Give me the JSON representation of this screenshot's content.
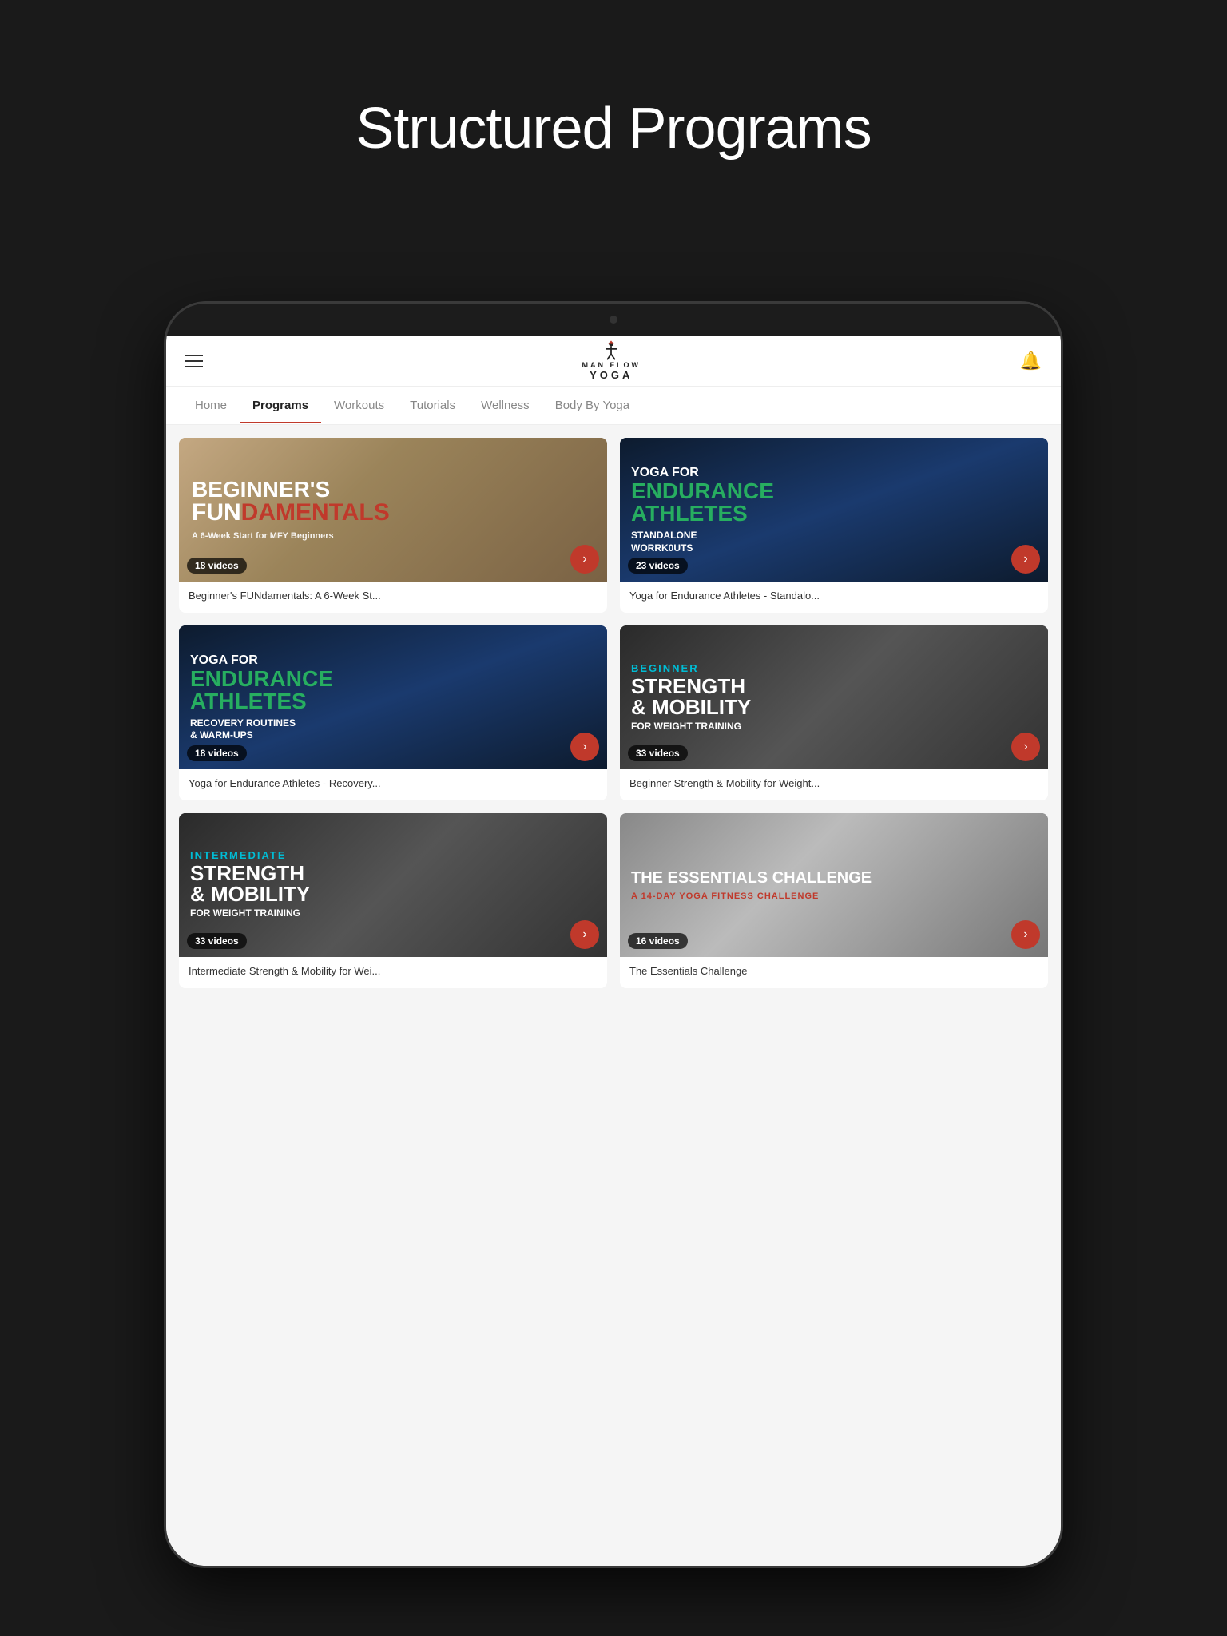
{
  "page": {
    "title": "Structured Programs",
    "background_color": "#1a1a1a"
  },
  "header": {
    "logo_line1": "MAN FLOW",
    "logo_line2": "YOGA",
    "bell_symbol": "🔔"
  },
  "nav": {
    "tabs": [
      {
        "label": "Home",
        "active": false
      },
      {
        "label": "Programs",
        "active": true
      },
      {
        "label": "Workouts",
        "active": false
      },
      {
        "label": "Tutorials",
        "active": false
      },
      {
        "label": "Wellness",
        "active": false
      },
      {
        "label": "Body By Yoga",
        "active": false
      }
    ]
  },
  "programs": [
    {
      "id": "beginners-fundamentals",
      "label_top": "",
      "title_line1": "BEGINNER'S",
      "title_line2": "FUNdamentals",
      "subtitle": "A 6-Week Start for MFY Beginners",
      "video_count": "18 videos",
      "card_title": "Beginner's FUNdamentals: A 6-Week St...",
      "theme": "beginners"
    },
    {
      "id": "endurance-standalone",
      "label_top": "",
      "title_line1": "YOGA FOR",
      "title_line2": "ENDURANCE",
      "title_line3": "ATHLETES",
      "subtitle": "STANDALONE\nWORRKOUTS",
      "video_count": "23 videos",
      "card_title": "Yoga for Endurance Athletes - Standalo...",
      "theme": "endurance-standalone"
    },
    {
      "id": "endurance-recovery",
      "label_top": "",
      "title_line1": "YOGA FOR",
      "title_line2": "ENDURANCE",
      "title_line3": "ATHLETES",
      "subtitle": "RECOVERY ROUTINES\n& WARM-UPS",
      "video_count": "18 videos",
      "card_title": "Yoga for Endurance Athletes - Recovery...",
      "theme": "endurance-recovery"
    },
    {
      "id": "strength-beginner",
      "label_top": "BEGINNER",
      "title_line1": "STRENGTH",
      "title_line2": "& MOBILITY",
      "subtitle": "FOR WEIGHT TRAINING",
      "video_count": "33 videos",
      "card_title": "Beginner Strength & Mobility for Weight...",
      "theme": "strength-beginner"
    },
    {
      "id": "strength-intermediate",
      "label_top": "INTERMEDIATE",
      "title_line1": "STRENGTH",
      "title_line2": "& MOBILITY",
      "subtitle": "FOR WEIGHT TRAINING",
      "video_count": "33 videos",
      "card_title": "Intermediate Strength & Mobility for Wei...",
      "theme": "strength-intermediate"
    },
    {
      "id": "essentials-challenge",
      "label_top": "",
      "title_line1": "THE ESSENTIALS CHALLENGE",
      "subtitle": "A 14-DAY YOGA FITNESS CHALLENGE",
      "video_count": "16 videos",
      "card_title": "The Essentials Challenge",
      "theme": "essentials"
    }
  ],
  "icons": {
    "hamburger": "☰",
    "bell": "🔔",
    "arrow_right": "›"
  }
}
